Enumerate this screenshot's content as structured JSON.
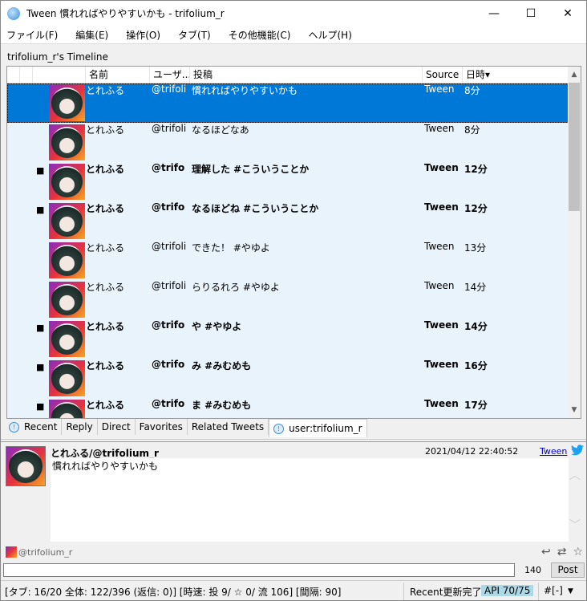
{
  "window": {
    "title": "Tween  慣れればやりやすいかも - trifolium_r",
    "minimize": "—",
    "maximize": "☐",
    "close": "✕"
  },
  "menu": [
    "ファイル(F)",
    "編集(E)",
    "操作(O)",
    "タブ(T)",
    "その他機能(C)",
    "ヘルプ(H)"
  ],
  "timeline_label": "trifolium_r's Timeline",
  "columns": {
    "name": "名前",
    "user": "ユーザ...",
    "post": "投稿",
    "source": "Source",
    "time": "日時▾"
  },
  "rows": [
    {
      "mark": "",
      "name": "とれふる",
      "user": "@trifoli",
      "text": "慣れればやりやすいかも",
      "source": "Tween",
      "time": "8分",
      "selected": true,
      "unread": false
    },
    {
      "mark": "",
      "name": "とれふる",
      "user": "@trifoli",
      "text": "なるほどなあ",
      "source": "Tween",
      "time": "8分",
      "selected": false,
      "unread": false
    },
    {
      "mark": "■",
      "name": "とれふる",
      "user": "@trifo",
      "text": "理解した #こういうことか",
      "source": "Tween",
      "time": "12分",
      "selected": false,
      "unread": true
    },
    {
      "mark": "■",
      "name": "とれふる",
      "user": "@trifo",
      "text": "なるほどね #こういうことか",
      "source": "Tween",
      "time": "12分",
      "selected": false,
      "unread": true
    },
    {
      "mark": "",
      "name": "とれふる",
      "user": "@trifoli",
      "text": "できた！ #やゆよ",
      "source": "Tween",
      "time": "13分",
      "selected": false,
      "unread": false
    },
    {
      "mark": "",
      "name": "とれふる",
      "user": "@trifoli",
      "text": "らりるれろ #やゆよ",
      "source": "Tween",
      "time": "14分",
      "selected": false,
      "unread": false
    },
    {
      "mark": "■",
      "name": "とれふる",
      "user": "@trifo",
      "text": "や #やゆよ",
      "source": "Tween",
      "time": "14分",
      "selected": false,
      "unread": true
    },
    {
      "mark": "■",
      "name": "とれふる",
      "user": "@trifo",
      "text": "み #みむめも",
      "source": "Tween",
      "time": "16分",
      "selected": false,
      "unread": true
    },
    {
      "mark": "■",
      "name": "とれふる",
      "user": "@trifo",
      "text": "ま #みむめも",
      "source": "Tween",
      "time": "17分",
      "selected": false,
      "unread": true
    }
  ],
  "tabs": [
    "Recent",
    "Reply",
    "Direct",
    "Favorites",
    "Related Tweets",
    "user:trifolium_r"
  ],
  "detail": {
    "name": "とれふる/@trifolium_r",
    "date": "2021/04/12 22:40:52",
    "source": "Tween",
    "body": "慣れればやりやすいかも"
  },
  "account": "@trifolium_r",
  "post": {
    "value": "",
    "count": "140",
    "button": "Post"
  },
  "status": {
    "stats": "[タブ: 16/20 全体: 122/396 (返信: 0)] [時速: 投 9/ ☆ 0/ 流 106] [間隔: 90]",
    "message": "Recent更新完了",
    "api": "API 70/75",
    "hashtag": "#[-]"
  }
}
